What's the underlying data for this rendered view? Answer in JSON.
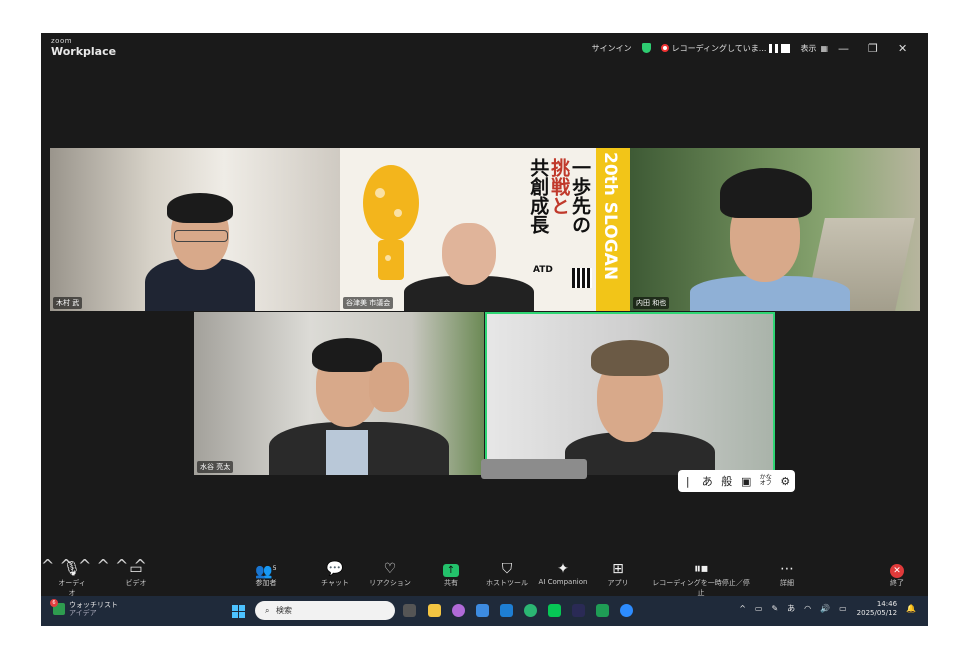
{
  "titlebar": {
    "brand_small": "zoom",
    "brand": "Workplace",
    "signin": "サインイン",
    "recording": "レコーディングしていま...",
    "view": "表示",
    "view_icon": "grid-icon"
  },
  "participants": [
    {
      "name": "木村 武"
    },
    {
      "name": "谷津美 市議会"
    },
    {
      "name": "内田 和也"
    },
    {
      "name": "水谷 亮太"
    },
    {
      "name": ""
    }
  ],
  "poster": {
    "headline_1": "一歩先の",
    "headline_2": "挑戦と",
    "headline_3": "共創成長",
    "strip": "20th SLOGAN",
    "logo": "ATD"
  },
  "ime_bar": {
    "item1": "|",
    "item2": "あ",
    "item3": "般",
    "item4": "",
    "item5_top": "かな",
    "item5_bottom": "オフ",
    "item6": "⚙"
  },
  "toolbar": {
    "audio": "オーディオ",
    "video": "ビデオ",
    "participants": "参加者",
    "participants_count": "5",
    "chat": "チャット",
    "reactions": "リアクション",
    "share": "共有",
    "host_tools": "ホストツール",
    "ai_companion": "AI Companion",
    "apps": "アプリ",
    "recording": "レコーディングを一時停止／停止",
    "more": "詳細",
    "end": "終了"
  },
  "taskbar": {
    "weather_title": "ウォッチリスト",
    "weather_sub": "アイデア",
    "weather_badge": "6",
    "search_placeholder": "検索",
    "time": "14:46",
    "date": "2025/05/12",
    "ime": "あ"
  },
  "colors": {
    "active_speaker": "#2ed573",
    "share": "#23c16b",
    "end": "#e03a3a",
    "poster_yellow": "#f2c518"
  }
}
